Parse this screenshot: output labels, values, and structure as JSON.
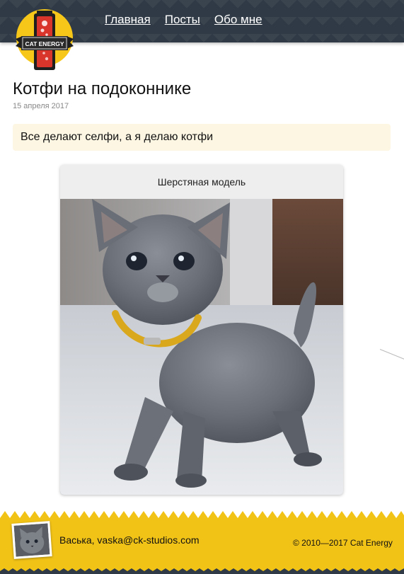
{
  "header": {
    "logo_text": "CAT ENERGY",
    "nav": [
      {
        "label": "Главная"
      },
      {
        "label": "Посты"
      },
      {
        "label": "Обо мне"
      }
    ]
  },
  "post": {
    "title": "Котфи на подоконнике",
    "date": "15 апреля 2017",
    "quote": "Все делают селфи, а я делаю котфи",
    "card_caption": "Шерстяная модель",
    "photo": "grey kitten with gold collar"
  },
  "footer": {
    "author": "Васька, vaska@ck-studios.com",
    "copyright": "© 2010—2017 Cat Energy"
  },
  "colors": {
    "header_bg": "#2f3a46",
    "footer_bg": "#f2c317",
    "quote_bg": "#fdf6e3",
    "logo_yellow": "#f6c719",
    "logo_red": "#d9352b"
  }
}
